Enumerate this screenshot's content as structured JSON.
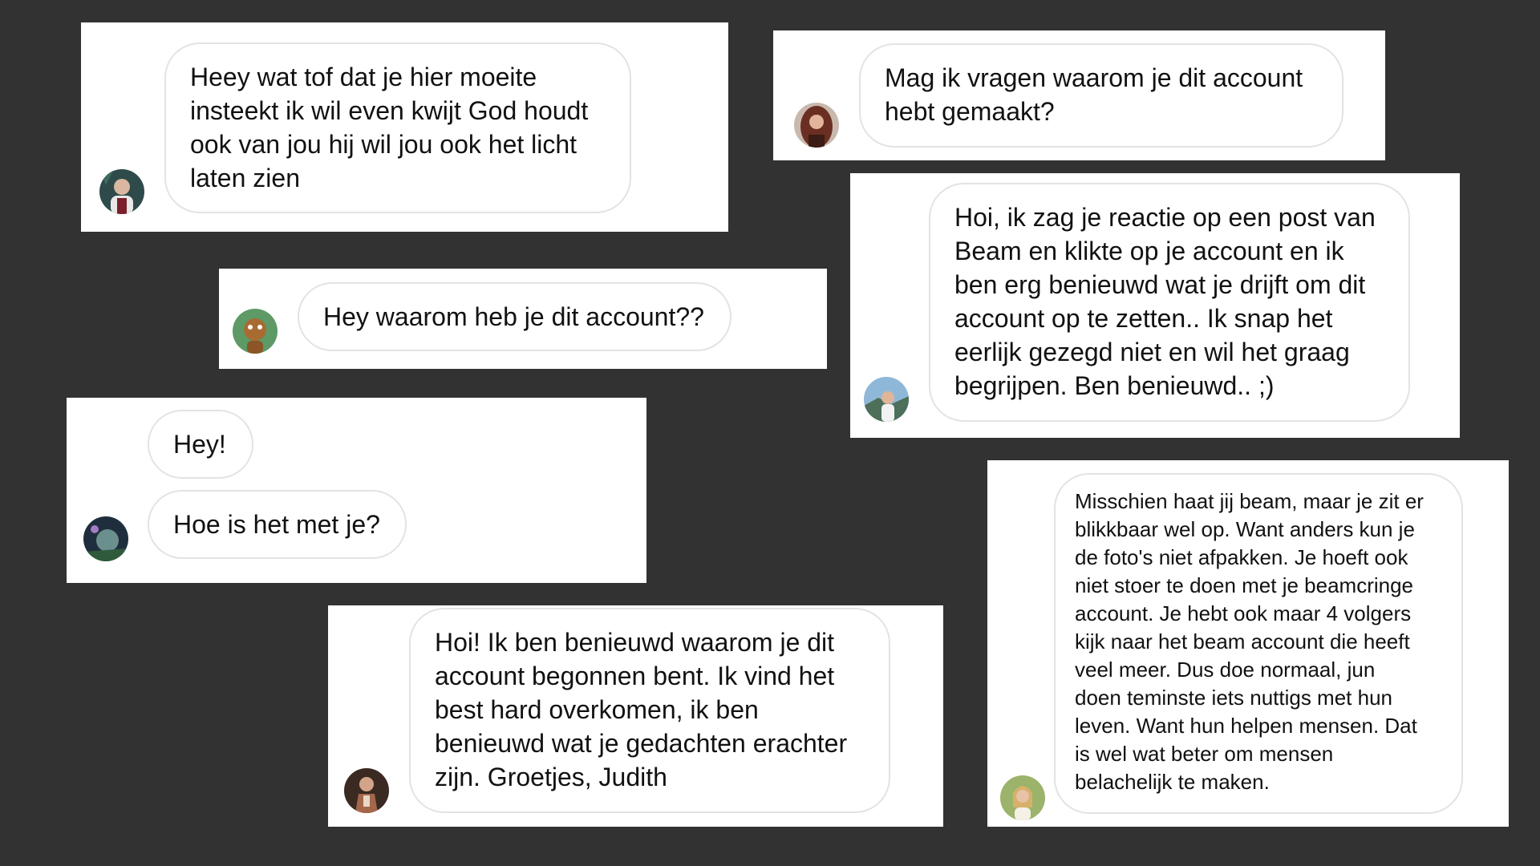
{
  "messages": {
    "m1": {
      "text": "Heey wat tof dat je hier moeite\ninsteekt ik wil even kwijt God houdt\nook van jou hij wil jou ook het licht\nlaten zien",
      "avatar_icon": "profile-photo-icon"
    },
    "m2": {
      "text": "Mag ik vragen waarom je dit account\nhebt gemaakt?",
      "avatar_icon": "profile-photo-icon"
    },
    "m3": {
      "text": "Hey waarom heb je dit account??",
      "avatar_icon": "profile-photo-icon"
    },
    "m4": {
      "text": "Hoi, ik zag je reactie op een post van\nBeam en klikte op je account en ik\nben erg benieuwd wat je drijft om dit\naccount op te zetten.. Ik snap het\neerlijk gezegd niet en wil het graag\nbegrijpen. Ben benieuwd.. ;)",
      "avatar_icon": "profile-photo-icon"
    },
    "m5": {
      "text_a": "Hey!",
      "text_b": "Hoe is het met je?",
      "avatar_icon": "profile-photo-icon"
    },
    "m6": {
      "text": "Hoi! Ik ben benieuwd waarom je dit\naccount begonnen bent. Ik vind het\nbest hard overkomen, ik ben\nbenieuwd wat je gedachten erachter\nzijn. Groetjes, Judith",
      "avatar_icon": "profile-photo-icon"
    },
    "m7": {
      "text": "Misschien haat jij beam, maar je zit er\nblikkbaar wel op. Want anders kun je\nde foto's niet afpakken. Je hoeft ook\nniet stoer te doen met je beamcringe\naccount. Je hebt ook maar 4 volgers\nkijk naar het beam account die heeft\nveel meer. Dus doe normaal, jun\ndoen teminste iets nuttigs met hun\nleven. Want hun helpen mensen. Dat\nis wel wat beter om mensen\nbelachelijk te maken.",
      "avatar_icon": "profile-photo-icon"
    }
  },
  "colors": {
    "background": "#323232",
    "card": "#ffffff",
    "bubble_border": "#e3e3e3",
    "text": "#111111"
  }
}
